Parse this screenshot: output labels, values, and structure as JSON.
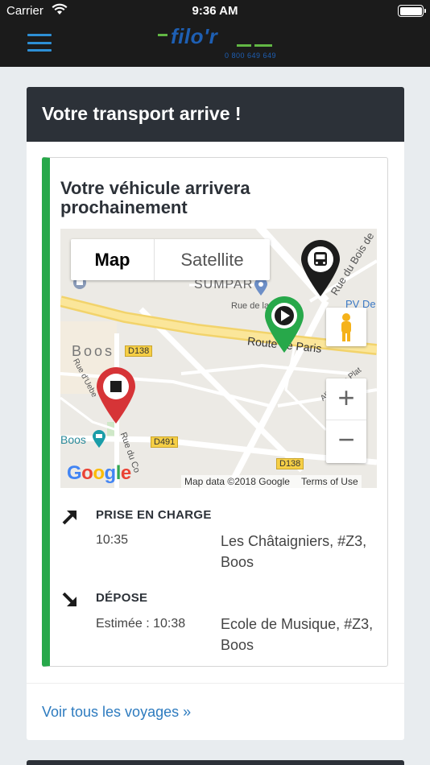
{
  "status_bar": {
    "carrier": "Carrier",
    "time": "9:36 AM"
  },
  "nav": {
    "logo_text": "filo'r",
    "logo_phone": "0 800 649 649"
  },
  "card": {
    "header_title": "Votre transport arrive !",
    "panel_title": "Votre véhicule arrivera prochainement",
    "footer_link": "Voir tous les voyages »"
  },
  "map": {
    "type_map": "Map",
    "type_satellite": "Satellite",
    "zoom_in": "+",
    "zoom_out": "−",
    "attribution_data": "Map data ©2018 Google",
    "attribution_terms": "Terms of Use",
    "google_logo": "Google",
    "labels": {
      "sumpar": "SUMPAR",
      "rue_de_la": "Rue de la",
      "route_de_paris": "Route de Paris",
      "rue_du_bois_de": "Rue du Bois de",
      "pv_de": "PV De",
      "boos_town": "Boos",
      "boos_poi": "Boos",
      "d138_left": "D138",
      "d138_bottom": "D138",
      "d491": "D491",
      "allee_des_plat": "Allée des Plat",
      "rue_du_co": "Rue du Co",
      "rue_d_uebe": "Rue d'Uebe"
    },
    "pins": [
      "bus-pin",
      "start-pin",
      "stop-pin"
    ]
  },
  "pickup": {
    "title": "PRISE EN CHARGE",
    "time": "10:35",
    "place": "Les Châtaigniers, #Z3, Boos"
  },
  "dropoff": {
    "title": "DÉPOSE",
    "time": "Estimée : 10:38",
    "place": "Ecole de Musique, #Z3, Boos"
  },
  "colors": {
    "accent_green": "#27a84a",
    "nav_blue": "#2d8fd5",
    "link_blue": "#2d7bbf",
    "header_dark": "#2c3138"
  }
}
